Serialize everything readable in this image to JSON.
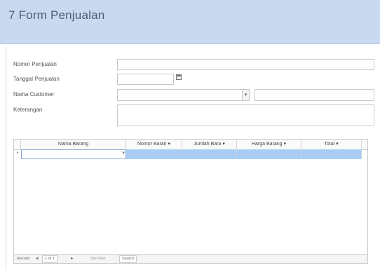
{
  "form": {
    "title": "7 Form Penjualan",
    "labels": {
      "nomor_penjualan": "Nomor Penjualan",
      "tanggal_penjualan": "Tanggal Penjualan",
      "nama_customer": "Nama Customer",
      "keterangan": "Keterangan"
    },
    "values": {
      "nomor_penjualan": "",
      "tanggal_penjualan": "",
      "nama_customer": "",
      "customer_detail": "",
      "keterangan": ""
    }
  },
  "subform": {
    "columns": [
      "Nama Barang",
      "Nomor Baran",
      "Jumlah Bara",
      "Harga Barang",
      "Total"
    ],
    "new_row_marker": "*",
    "dropdown_glyph": "▾",
    "navigation": {
      "record_label": "Record:",
      "first": "◄",
      "current": "1 of 1",
      "next": "►",
      "filter": "No Filter",
      "search": "Search"
    }
  },
  "colors": {
    "header_bg": "#c9daf0",
    "selected_row": "#a8ccf2"
  }
}
